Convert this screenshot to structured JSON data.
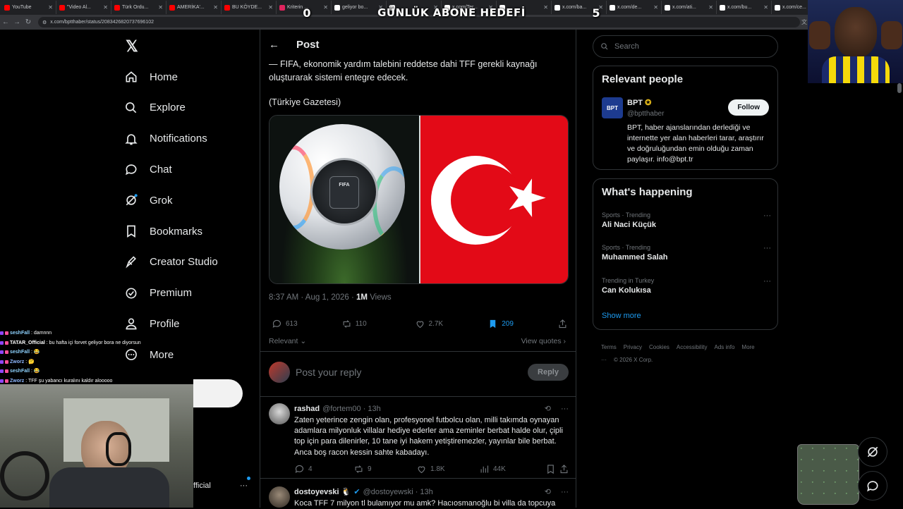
{
  "browser": {
    "tabs": [
      {
        "title": "YouTube",
        "color": "#ff0000"
      },
      {
        "title": "\"Video Al...",
        "color": "#ff0000"
      },
      {
        "title": "Türk Ordu...",
        "color": "#ff0000"
      },
      {
        "title": "AMERİKA'...",
        "color": "#ff0000"
      },
      {
        "title": "BU KÖYDE...",
        "color": "#ff0000"
      },
      {
        "title": "Kriterin ...",
        "color": "#e0245e"
      },
      {
        "title": "geliyor bo...",
        "color": "#ffffff"
      },
      {
        "title": "",
        "color": "#ffffff"
      },
      {
        "title": "x.com/Ter...",
        "color": "#ffffff"
      },
      {
        "title": "",
        "color": "#ffffff"
      },
      {
        "title": "x.com/ba...",
        "color": "#ffffff"
      },
      {
        "title": "x.com/de...",
        "color": "#ffffff"
      },
      {
        "title": "x.com/ati...",
        "color": "#ffffff"
      },
      {
        "title": "x.com/bu...",
        "color": "#ffffff"
      },
      {
        "title": "x.com/ce...",
        "color": "#ffffff"
      },
      {
        "title": "x.com/ca...",
        "color": "#ffffff"
      },
      {
        "title": "BPT on X",
        "color": "#ffffff"
      }
    ],
    "url": "x.com/bptthaber/status/2083426820737696102"
  },
  "overlay": {
    "goal_left": "0",
    "goal_title": "GÜNLÜK ABONE HEDEFİ",
    "goal_right": "5"
  },
  "chat": [
    {
      "user": "seshFall",
      "msg": ": damnnn",
      "color": "#8fd3ff"
    },
    {
      "user": "TATAR_Official",
      "msg": ": bu hafta içi forvet geliyor bora ne diyorsun",
      "color": "#ffffff"
    },
    {
      "user": "seshFall",
      "msg": ": 😂",
      "color": "#8fd3ff"
    },
    {
      "user": "Zworz",
      "msg": ": 🤔",
      "color": "#8fb8ff"
    },
    {
      "user": "seshFall",
      "msg": ": 😂",
      "color": "#8fd3ff"
    },
    {
      "user": "Zworz",
      "msg": ": TFF şu yabancı kuralını kaldır alooooo",
      "color": "#8fb8ff"
    }
  ],
  "nav": {
    "logo": "𝕏",
    "items": [
      "Home",
      "Explore",
      "Notifications",
      "Chat",
      "Grok",
      "Bookmarks",
      "Creator Studio",
      "Premium",
      "Profile",
      "More"
    ],
    "account_partial": "fficial"
  },
  "post": {
    "header_title": "Post",
    "text_line1": "— FIFA, ekonomik yardım talebini reddetse dahi TFF gerekli kaynağı",
    "text_line2": "oluşturarak sistemi entegre edecek.",
    "source": "(Türkiye Gazetesi)",
    "ball_label": "FIFA",
    "meta_time": "8:37 AM · Aug 1, 2026 · ",
    "meta_views_count": "1M",
    "meta_views_label": " Views",
    "replies": "613",
    "reposts": "110",
    "likes": "2.7K",
    "bookmarks": "209",
    "sort_label": "Relevant",
    "view_quotes": "View quotes",
    "reply_placeholder": "Post your reply",
    "reply_button": "Reply"
  },
  "replies": [
    {
      "name": "rashad",
      "handle": "@fortem00 · 13h",
      "text": "Zaten yeterince zengin olan, profesyonel futbolcu olan, milli takımda oynayan adamlara milyonluk villalar hediye ederler ama zeminler berbat halde olur, çipli top için para dilenirler, 10 tane iyi hakem yetiştiremezler, yayınlar bile berbat. Anca boş racon kessin sahte kabadayı.",
      "replies": "4",
      "reposts": "9",
      "likes": "1.8K",
      "views": "44K"
    },
    {
      "name": "dostoyevski 🐧",
      "handle": "@dostoyewski · 13h",
      "text": "Koca TFF 7 milyon tl bulamıyor mu amk? Hacıosmanoğlu bi villa da topcuya"
    }
  ],
  "right": {
    "search_placeholder": "Search",
    "relevant_title": "Relevant people",
    "person_name": "BPT",
    "person_handle": "@bptthaber",
    "person_avatar": "BPT",
    "follow_label": "Follow",
    "person_bio": "BPT, haber ajanslarından derlediği ve internette yer alan haberleri tarar, araştırır ve doğruluğundan emin olduğu zaman paylaşır. info@bpt.tr",
    "happening_title": "What's happening",
    "trends": [
      {
        "cat": "Sports · Trending",
        "title": "Ali Naci Küçük"
      },
      {
        "cat": "Sports · Trending",
        "title": "Muhammed Salah"
      },
      {
        "cat": "Trending in Turkey",
        "title": "Can Kolukısa"
      }
    ],
    "show_more": "Show more",
    "footer": [
      "Terms",
      "Privacy",
      "Cookies",
      "Accessibility",
      "Ads info",
      "More ···",
      "© 2026 X Corp."
    ]
  },
  "colors": {
    "accent": "#1d9bf0",
    "bookmark_active": "#1d9bf0",
    "turk_red": "#e30a17"
  }
}
